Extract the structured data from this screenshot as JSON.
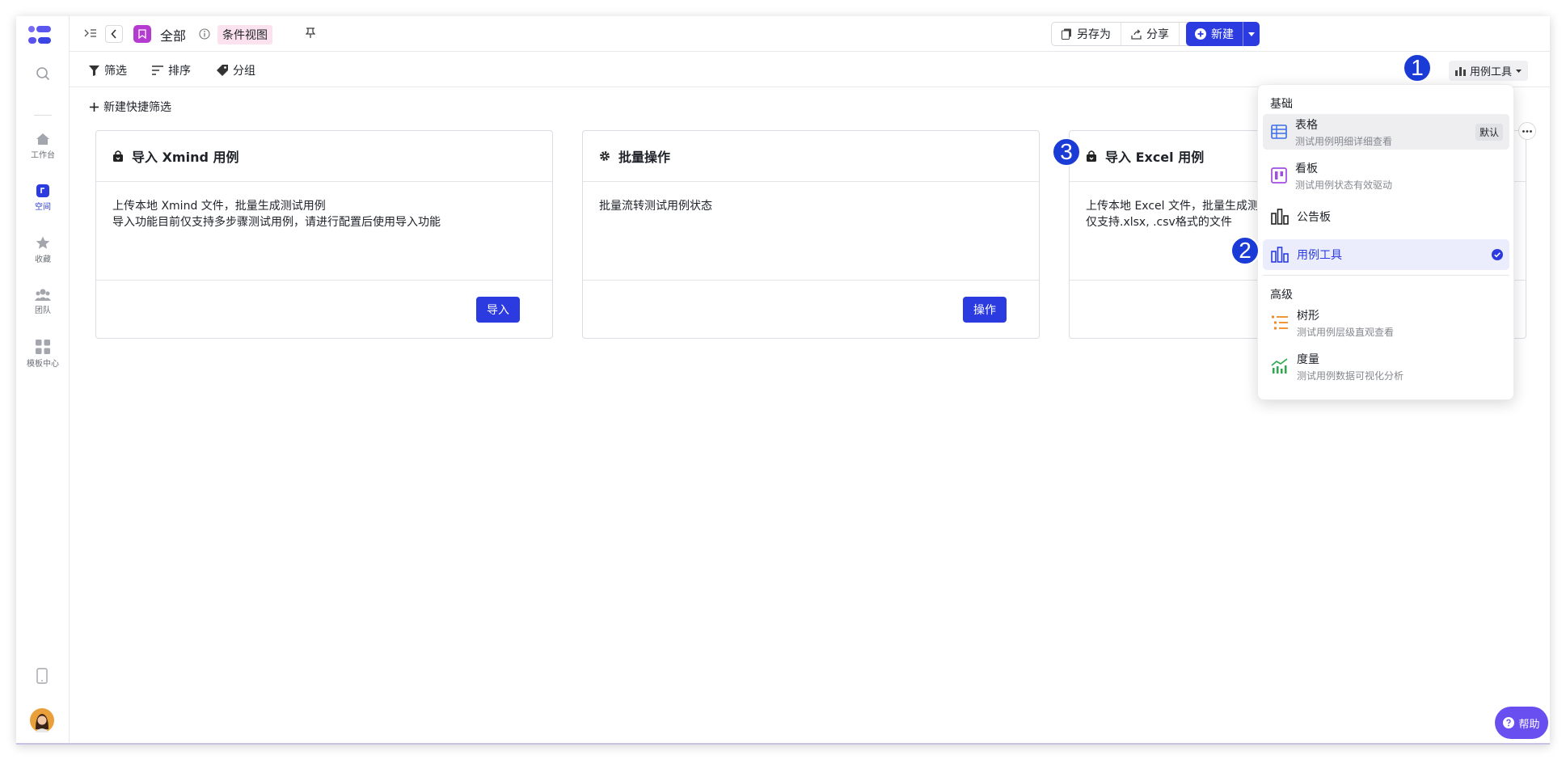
{
  "header": {
    "title": "全部",
    "view_tag": "条件视图",
    "save_as": "另存为",
    "share": "分享",
    "new": "新建"
  },
  "toolbar": {
    "filter": "筛选",
    "sort": "排序",
    "group": "分组",
    "view_switch": "用例工具",
    "new_quick_filter": "新建快捷筛选"
  },
  "rail": {
    "items": [
      {
        "label": "工作台"
      },
      {
        "label": "空间"
      },
      {
        "label": "收藏"
      },
      {
        "label": "团队"
      },
      {
        "label": "模板中心"
      }
    ]
  },
  "cards": [
    {
      "title": "导入 Xmind 用例",
      "line1": "上传本地 Xmind 文件，批量生成测试用例",
      "line2": "导入功能目前仅支持多步骤测试用例，请进行配置后使用导入功能",
      "button": "导入"
    },
    {
      "title": "批量操作",
      "line1": "批量流转测试用例状态",
      "line2": "",
      "button": "操作"
    },
    {
      "title": "导入 Excel 用例",
      "line1": "上传本地 Excel 文件，批量生成测",
      "line2": "仅支持.xlsx, .csv格式的文件",
      "button": ""
    }
  ],
  "menu": {
    "basic_label": "基础",
    "advanced_label": "高级",
    "items": [
      {
        "title": "表格",
        "sub": "测试用例明细详细查看",
        "badge": "默认"
      },
      {
        "title": "看板",
        "sub": "测试用例状态有效驱动"
      },
      {
        "title": "公告板",
        "sub": ""
      },
      {
        "title": "用例工具",
        "sub": ""
      },
      {
        "title": "树形",
        "sub": "测试用例层级直观查看"
      },
      {
        "title": "度量",
        "sub": "测试用例数据可视化分析"
      }
    ]
  },
  "annotations": [
    "1",
    "2",
    "3"
  ],
  "help": "帮助",
  "colors": {
    "primary": "#2b3be0",
    "accent_purple": "#6a4ff0",
    "selected_bg": "#ebedfc"
  }
}
